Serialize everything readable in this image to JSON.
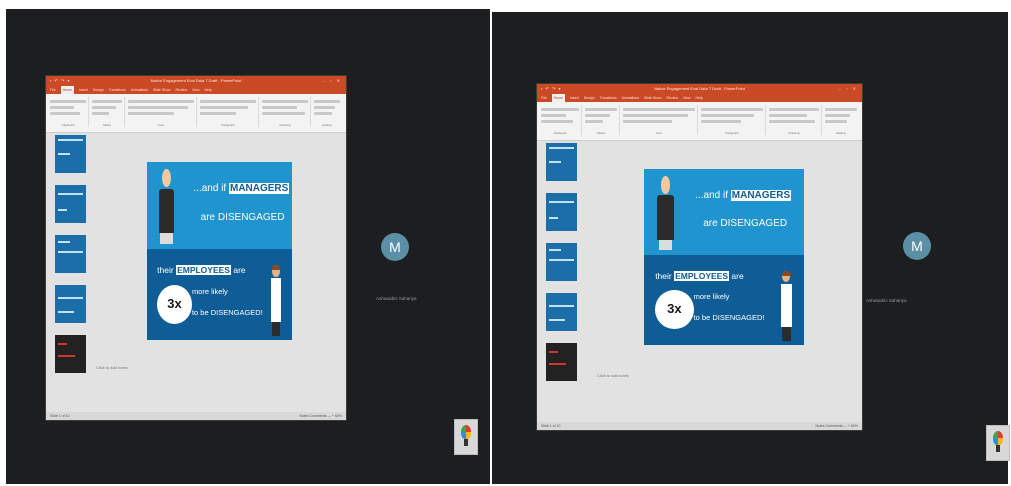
{
  "screens": [
    {
      "ppt": {
        "title": "Native Engagement Eval Data 7 Draft - PowerPoint",
        "quick_access": "▪ ↶ ↷ ▾",
        "window_controls": "– ▫ ✕",
        "tabs": [
          "File",
          "Home",
          "Insert",
          "Design",
          "Transitions",
          "Animations",
          "Slide Show",
          "Review",
          "View",
          "Help"
        ],
        "active_tab": "Home",
        "ribbon_groups": [
          "Clipboard",
          "Slides",
          "Font",
          "Paragraph",
          "Drawing",
          "Editing"
        ],
        "thumb_numbers": [
          "1",
          "2",
          "3",
          "4",
          "5"
        ],
        "notes_placeholder": "Click to add notes",
        "status_left": "Slide 1 of 10",
        "status_right": "Notes  Comments  — + 60%"
      },
      "slide": {
        "line1_pre": "...and if",
        "line1_hl": "MANAGERS",
        "line2": "are DISENGAGED",
        "line3_pre": "their",
        "line3_hl": "EMPLOYEES",
        "line3_post": "are",
        "line4": "more likely",
        "line5": "to be DISENGAGED!",
        "badge": "3x"
      },
      "participant": {
        "initial": "M",
        "name": "Ashwaidini Sahariya"
      }
    },
    {
      "ppt": {
        "title": "Native Engagement Eval Data 7 Draft - PowerPoint",
        "quick_access": "▪ ↶ ↷ ▾",
        "window_controls": "– ▫ ✕",
        "tabs": [
          "File",
          "Home",
          "Insert",
          "Design",
          "Transitions",
          "Animations",
          "Slide Show",
          "Review",
          "View",
          "Help"
        ],
        "active_tab": "Home",
        "ribbon_groups": [
          "Clipboard",
          "Slides",
          "Font",
          "Paragraph",
          "Drawing",
          "Editing"
        ],
        "thumb_numbers": [
          "1",
          "2",
          "3",
          "4",
          "5"
        ],
        "notes_placeholder": "Click to add notes",
        "status_left": "Slide 1 of 10",
        "status_right": "Notes  Comments  — + 60%"
      },
      "slide": {
        "line1_pre": "...and if",
        "line1_hl": "MANAGERS",
        "line2": "are DISENGAGED",
        "line3_pre": "their",
        "line3_hl": "EMPLOYEES",
        "line3_post": "are",
        "line4": "more likely",
        "line5": "to be DISENGAGED!",
        "badge": "3x"
      },
      "participant": {
        "initial": "M",
        "name": "Ashwaidini Sahariya"
      }
    }
  ],
  "colors": {
    "background": "#1c1e1f",
    "ppt_accent": "#c94a25",
    "slide_blue": "#1f94cf",
    "slide_dark_blue": "#0e5d97",
    "avatar": "#5a8fa6"
  }
}
